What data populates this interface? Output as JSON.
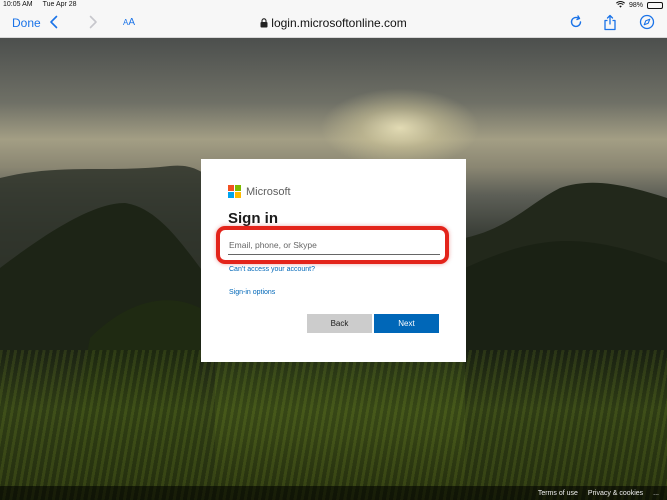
{
  "status_bar": {
    "time": "10:05 AM",
    "date": "Tue Apr 28",
    "battery": "98%",
    "battery_level": 0.98
  },
  "toolbar": {
    "done_label": "Done",
    "text_size_label_small": "A",
    "text_size_label_large": "A",
    "url": "login.microsoftonline.com",
    "accent_color": "#1a73e8"
  },
  "card": {
    "brand_name": "Microsoft",
    "brand_colors": [
      "#f25022",
      "#7fba00",
      "#00a4ef",
      "#ffb900"
    ],
    "title": "Sign in",
    "email_placeholder": "Email, phone, or Skype",
    "cant_access_link": "Can’t access your account?",
    "signin_options_link": "Sign-in options",
    "back_label": "Back",
    "next_label": "Next",
    "next_color": "#0067b8",
    "highlight_color": "#e3241b"
  },
  "footer": {
    "terms": "Terms of use",
    "privacy": "Privacy & cookies",
    "more": "..."
  }
}
